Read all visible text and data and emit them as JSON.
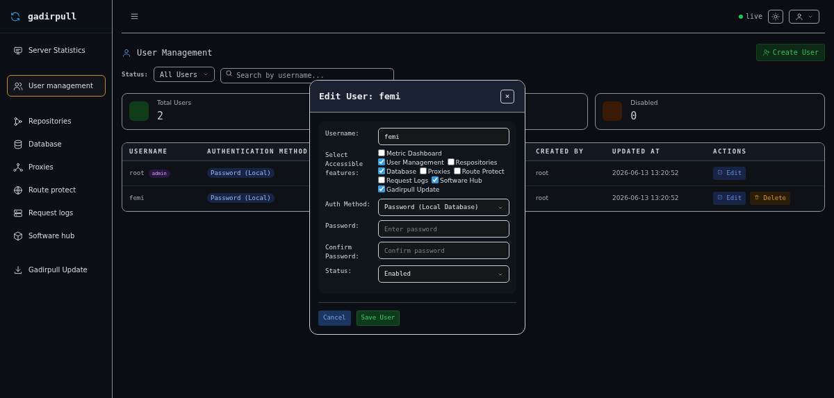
{
  "sidebar": {
    "brand": "gadirpull",
    "sections": [
      [
        {
          "label": "Server Statistics",
          "selected": false
        }
      ],
      [
        {
          "label": "User management",
          "selected": true
        }
      ],
      [
        {
          "label": "Repositories",
          "selected": false
        },
        {
          "label": "Database",
          "selected": false
        },
        {
          "label": "Proxies",
          "selected": false
        },
        {
          "label": "Route protect",
          "selected": false
        },
        {
          "label": "Request logs",
          "selected": false
        },
        {
          "label": "Software hub",
          "selected": false
        }
      ],
      [
        {
          "label": "Gadirpull Update",
          "selected": false
        }
      ]
    ]
  },
  "topbar": {
    "status": "live"
  },
  "page": {
    "title": "User Management",
    "create_button": "Create User",
    "filter": {
      "label": "Status:",
      "value": "All Users"
    },
    "search": {
      "placeholder": "Search by username..."
    },
    "stats": [
      {
        "label": "Total Users",
        "value": "2",
        "color": "#0f3d1a"
      },
      {
        "label": "Disabled",
        "value": "0",
        "color": "#3a1a05"
      }
    ],
    "table": {
      "columns": [
        "USERNAME",
        "AUTHENTICATION METHOD",
        null,
        "CREATED BY",
        "UPDATED AT",
        "ACTIONS"
      ],
      "rows": [
        {
          "username": "root",
          "badge": "admin",
          "auth": "Password (Local)",
          "created_by": "root",
          "updated_at": "2026-06-13 13:20:52",
          "actions": [
            "Edit"
          ]
        },
        {
          "username": "femi",
          "auth": "Password (Local)",
          "created_by": "root",
          "updated_at": "2026-06-13 13:20:52",
          "actions": [
            "Edit",
            "Delete"
          ]
        }
      ]
    }
  },
  "modal": {
    "title": "Edit User: femi",
    "close": "×",
    "username": {
      "label": "Username:",
      "value": "femi"
    },
    "features_label": "Select Accessible features:",
    "features": [
      {
        "label": "Metric Dashboard",
        "checked": false
      },
      {
        "label": "User Management",
        "checked": true
      },
      {
        "label": "Respositories",
        "checked": false
      },
      {
        "label": "Database",
        "checked": true
      },
      {
        "label": "Proxies",
        "checked": false
      },
      {
        "label": "Route Protect",
        "checked": false
      },
      {
        "label": "Request Logs",
        "checked": false
      },
      {
        "label": "Software Hub",
        "checked": true
      },
      {
        "label": "Gadirpull Update",
        "checked": true
      }
    ],
    "auth": {
      "label": "Auth Method:",
      "value": "Password (Local Database)"
    },
    "password": {
      "label": "Password:",
      "placeholder": "Enter password"
    },
    "confirm": {
      "label": "Confirm Password:",
      "placeholder": "Confirm password"
    },
    "status": {
      "label": "Status:",
      "value": "Enabled"
    },
    "buttons": [
      {
        "label": "Cancel",
        "kind": "cancel"
      },
      {
        "label": "Save User",
        "kind": "save"
      }
    ]
  }
}
